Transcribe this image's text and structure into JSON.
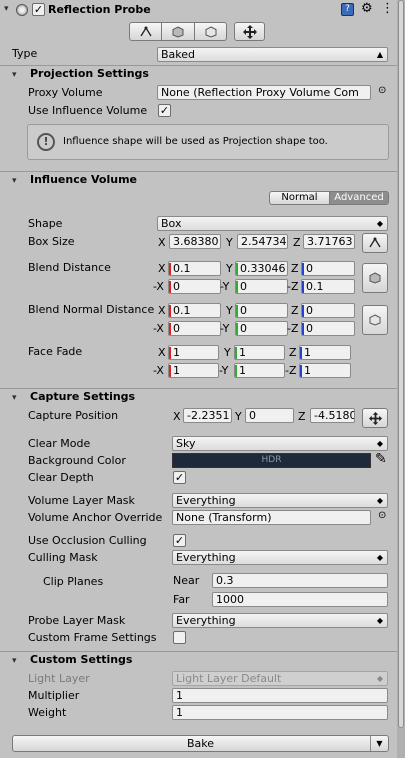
{
  "component": {
    "title": "Reflection Probe",
    "type_label": "Type",
    "type_value": "Baked"
  },
  "projection": {
    "header": "Projection Settings",
    "proxy_label": "Proxy Volume",
    "proxy_value": "None (Reflection Proxy Volume Com",
    "use_influence_label": "Use Influence Volume",
    "info_text": "Influence shape will be used as Projection shape too."
  },
  "influence": {
    "header": "Influence Volume",
    "mode_normal": "Normal",
    "mode_advanced": "Advanced",
    "shape_label": "Shape",
    "shape_value": "Box",
    "box_size_label": "Box Size",
    "box_size": {
      "x": "3.68380",
      "y": "2.54734",
      "z": "3.71763"
    },
    "blend_distance_label": "Blend Distance",
    "blend_distance": {
      "px": "0.1",
      "py": "0.33046",
      "pz": "0",
      "nx": "0",
      "ny": "0",
      "nz": "0.1"
    },
    "blend_normal_label": "Blend Normal Distance",
    "blend_normal": {
      "px": "0.1",
      "py": "0",
      "pz": "0",
      "nx": "0",
      "ny": "0",
      "nz": "0"
    },
    "face_fade_label": "Face Fade",
    "face_fade": {
      "px": "1",
      "py": "1",
      "pz": "1",
      "nx": "1",
      "ny": "1",
      "nz": "1"
    }
  },
  "axes": {
    "x": "X",
    "y": "Y",
    "z": "Z",
    "nx": "-X",
    "ny": "-Y",
    "nz": "-Z"
  },
  "capture": {
    "header": "Capture Settings",
    "position_label": "Capture Position",
    "position": {
      "x": "-2.2351",
      "y": "0",
      "z": "-4.5180"
    },
    "clear_mode_label": "Clear Mode",
    "clear_mode_value": "Sky",
    "bg_color_label": "Background Color",
    "bg_color_text": "HDR",
    "bg_color_hex": "#1e2a3b",
    "clear_depth_label": "Clear Depth",
    "volume_layer_mask_label": "Volume Layer Mask",
    "volume_layer_mask_value": "Everything",
    "volume_anchor_label": "Volume Anchor Override",
    "volume_anchor_value": "None (Transform)",
    "occlusion_label": "Use Occlusion Culling",
    "culling_mask_label": "Culling Mask",
    "culling_mask_value": "Everything",
    "clip_planes_label": "Clip Planes",
    "near_label": "Near",
    "near_value": "0.3",
    "far_label": "Far",
    "far_value": "1000",
    "probe_layer_mask_label": "Probe Layer Mask",
    "probe_layer_mask_value": "Everything",
    "custom_frame_label": "Custom Frame Settings"
  },
  "custom": {
    "header": "Custom Settings",
    "light_layer_label": "Light Layer",
    "light_layer_value": "Light Layer Default",
    "multiplier_label": "Multiplier",
    "multiplier_value": "1",
    "weight_label": "Weight",
    "weight_value": "1"
  },
  "bake_label": "Bake"
}
